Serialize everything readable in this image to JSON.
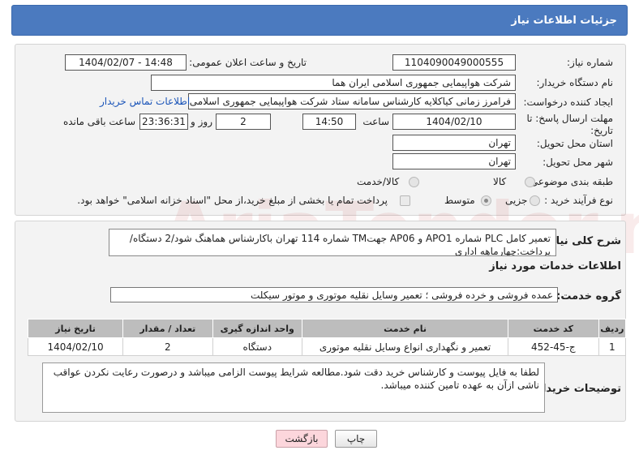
{
  "header": {
    "title": "جزئیات اطلاعات نیاز"
  },
  "form": {
    "need_number_label": "شماره نیاز:",
    "need_number": "1104090049000555",
    "announce_label": "تاریخ و ساعت اعلان عمومی:",
    "announce_value": "1404/02/07 - 14:48",
    "buyer_org_label": "نام دستگاه خریدار:",
    "buyer_org": "شرکت هواپیمایی جمهوری اسلامی ایران هما",
    "creator_label": "ایجاد کننده درخواست:",
    "creator": "فرامرز زمانی کیاکلایه کارشناس سامانه ستاد شرکت هواپیمایی جمهوری اسلامی",
    "contact_link": "اطلاعات تماس خریدار",
    "deadline_label": "مهلت ارسال پاسخ: تا تاریخ:",
    "deadline_date": "1404/02/10",
    "time_label": "ساعت",
    "deadline_time": "14:50",
    "days_value": "2",
    "days_label": "روز و",
    "remaining_time": "23:36:31",
    "remaining_label": "ساعت باقی مانده",
    "province_label": "استان محل تحویل:",
    "province": "تهران",
    "city_label": "شهر محل تحویل:",
    "city": "تهران",
    "category_label": "طبقه بندی موضوعی:",
    "category_options": [
      "کالا",
      "کالا/خدمت"
    ],
    "category_selected": "",
    "process_label": "نوع فرآیند خرید :",
    "process_options": [
      "جزیی",
      "متوسط"
    ],
    "process_selected": "متوسط",
    "payment_note": "پرداخت تمام یا بخشی از مبلغ خرید،از محل \"اسناد خزانه اسلامی\" خواهد بود."
  },
  "description": {
    "label": "شرح کلی نیاز:",
    "text": "تعمیر کامل PLC شماره  APO1 و AP06 جهتTM  شماره 114 تهران باکارشناس هماهنگ شود/2 دستگاه/پرداخت:چهارماهه اداری"
  },
  "services": {
    "section_title": "اطلاعات خدمات مورد نیاز",
    "group_label": "گروه خدمت:",
    "group_value": "عمده فروشی و خرده فروشی ؛ تعمیر وسایل نقلیه موتوری و موتور سیکلت",
    "columns": [
      "ردیف",
      "کد خدمت",
      "نام خدمت",
      "واحد اندازه گیری",
      "تعداد / مقدار",
      "تاریخ نیاز"
    ],
    "rows": [
      [
        "1",
        "ج-45-452",
        "تعمیر و نگهداری انواع وسایل نقلیه موتوری",
        "دستگاه",
        "2",
        "1404/02/10"
      ]
    ]
  },
  "buyer_notes": {
    "label": "توضیحات خریدار:",
    "text": "لطفا به فایل پیوست و کارشناس خرید دقت شود.مطالعه شرایط پیوست الزامی میباشد و درصورت رعایت نکردن عواقب ناشی ازآن به عهده تامین کننده میباشد."
  },
  "actions": {
    "print": "چاپ",
    "back": "بازگشت"
  },
  "watermark": {
    "text": "AriaTender.net"
  }
}
